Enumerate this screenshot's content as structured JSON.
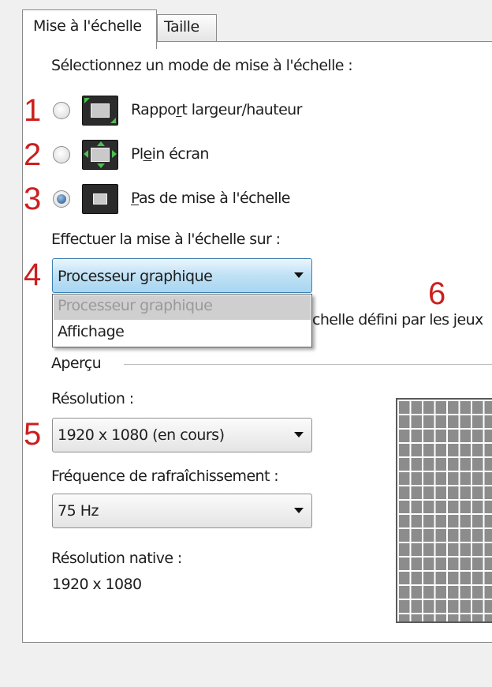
{
  "tabs": {
    "scaling": "Mise à l'échelle",
    "size": "Taille"
  },
  "scaling_mode": {
    "heading": "Sélectionnez un mode de mise à l'échelle :",
    "options": [
      {
        "pre": "Rappo",
        "ul": "r",
        "post": "t largeur/hauteur",
        "checked": false,
        "icon": "aspect-ratio-icon"
      },
      {
        "pre": "Pl",
        "ul": "e",
        "post": "in écran",
        "checked": false,
        "icon": "full-screen-icon"
      },
      {
        "pre": "",
        "ul": "P",
        "post": "as de mise à l'échelle",
        "checked": true,
        "icon": "no-scaling-icon"
      }
    ]
  },
  "perform_on": {
    "label": "Effectuer la mise à l'échelle sur :",
    "selected": "Processeur graphique",
    "options": [
      "Processeur graphique",
      "Affichage"
    ]
  },
  "override_text": "chelle défini par les jeux",
  "preview": {
    "label": "Aperçu",
    "resolution_label": "Résolution :",
    "resolution_value": "1920 x 1080 (en cours)",
    "refresh_label": "Fréquence de rafraîchissement :",
    "refresh_value": "75 Hz",
    "native_label": "Résolution native :",
    "native_value": "1920 x 1080"
  },
  "annotations": [
    "1",
    "2",
    "3",
    "4",
    "5",
    "6"
  ],
  "colors": {
    "annotation": "#cc1f1f",
    "focus_border": "#3c7fb1",
    "radio_dot": "#1e4f86"
  }
}
